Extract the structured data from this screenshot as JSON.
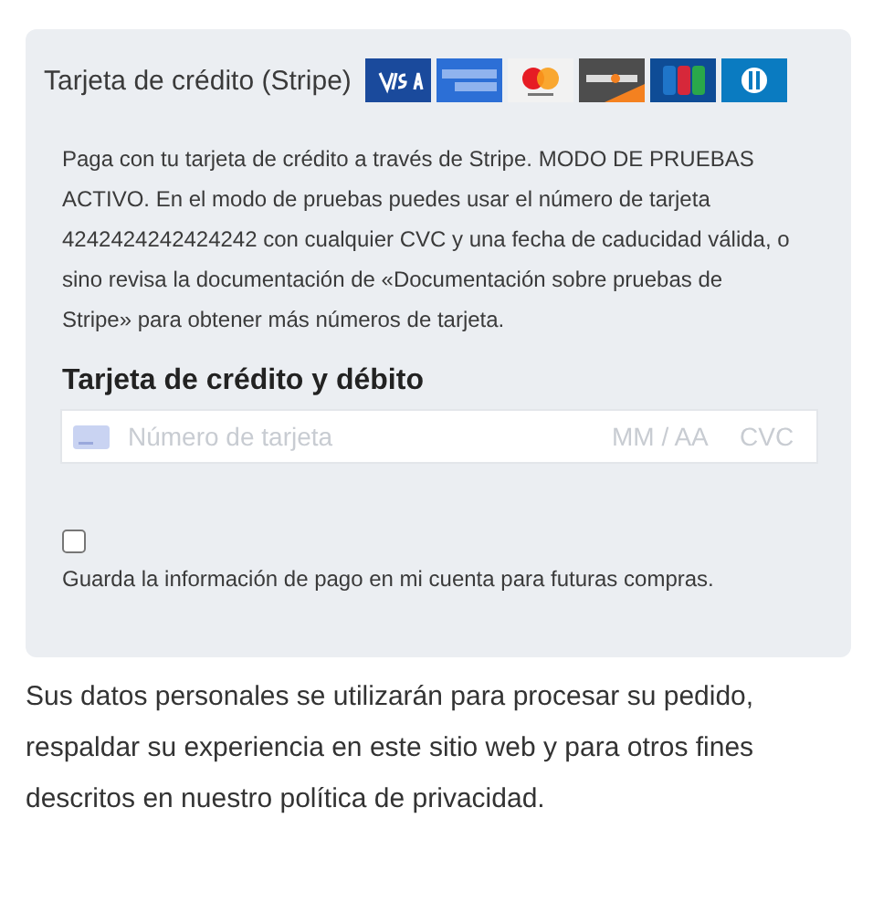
{
  "payment_method": {
    "title": "Tarjeta de crédito (Stripe)",
    "card_logos": [
      {
        "kind": "visa"
      },
      {
        "kind": "amex"
      },
      {
        "kind": "mastercard"
      },
      {
        "kind": "discover"
      },
      {
        "kind": "jcb"
      },
      {
        "kind": "diners"
      }
    ],
    "description": "Paga con tu tarjeta de crédito a través de Stripe. MODO DE PRUEBAS ACTIVO. En el modo de pruebas puedes usar el número de tarjeta 4242424242424242 con cualquier CVC y una fecha de caducidad válida, o sino revisa la documentación de «Documentación sobre pruebas de Stripe» para obtener más números de tarjeta.",
    "form_heading": "Tarjeta de crédito y débito",
    "card_field": {
      "placeholder": "Número de tarjeta",
      "expiry_placeholder": "MM / AA",
      "cvc_placeholder": "CVC"
    },
    "save_info": {
      "checked": false,
      "label": "Guarda la información de pago en mi cuenta para futuras compras."
    }
  },
  "privacy_note": "Sus datos personales se utilizarán para procesar su pedido, respaldar su experiencia en este sitio web y para otros fines descritos en nuestro política de privacidad."
}
